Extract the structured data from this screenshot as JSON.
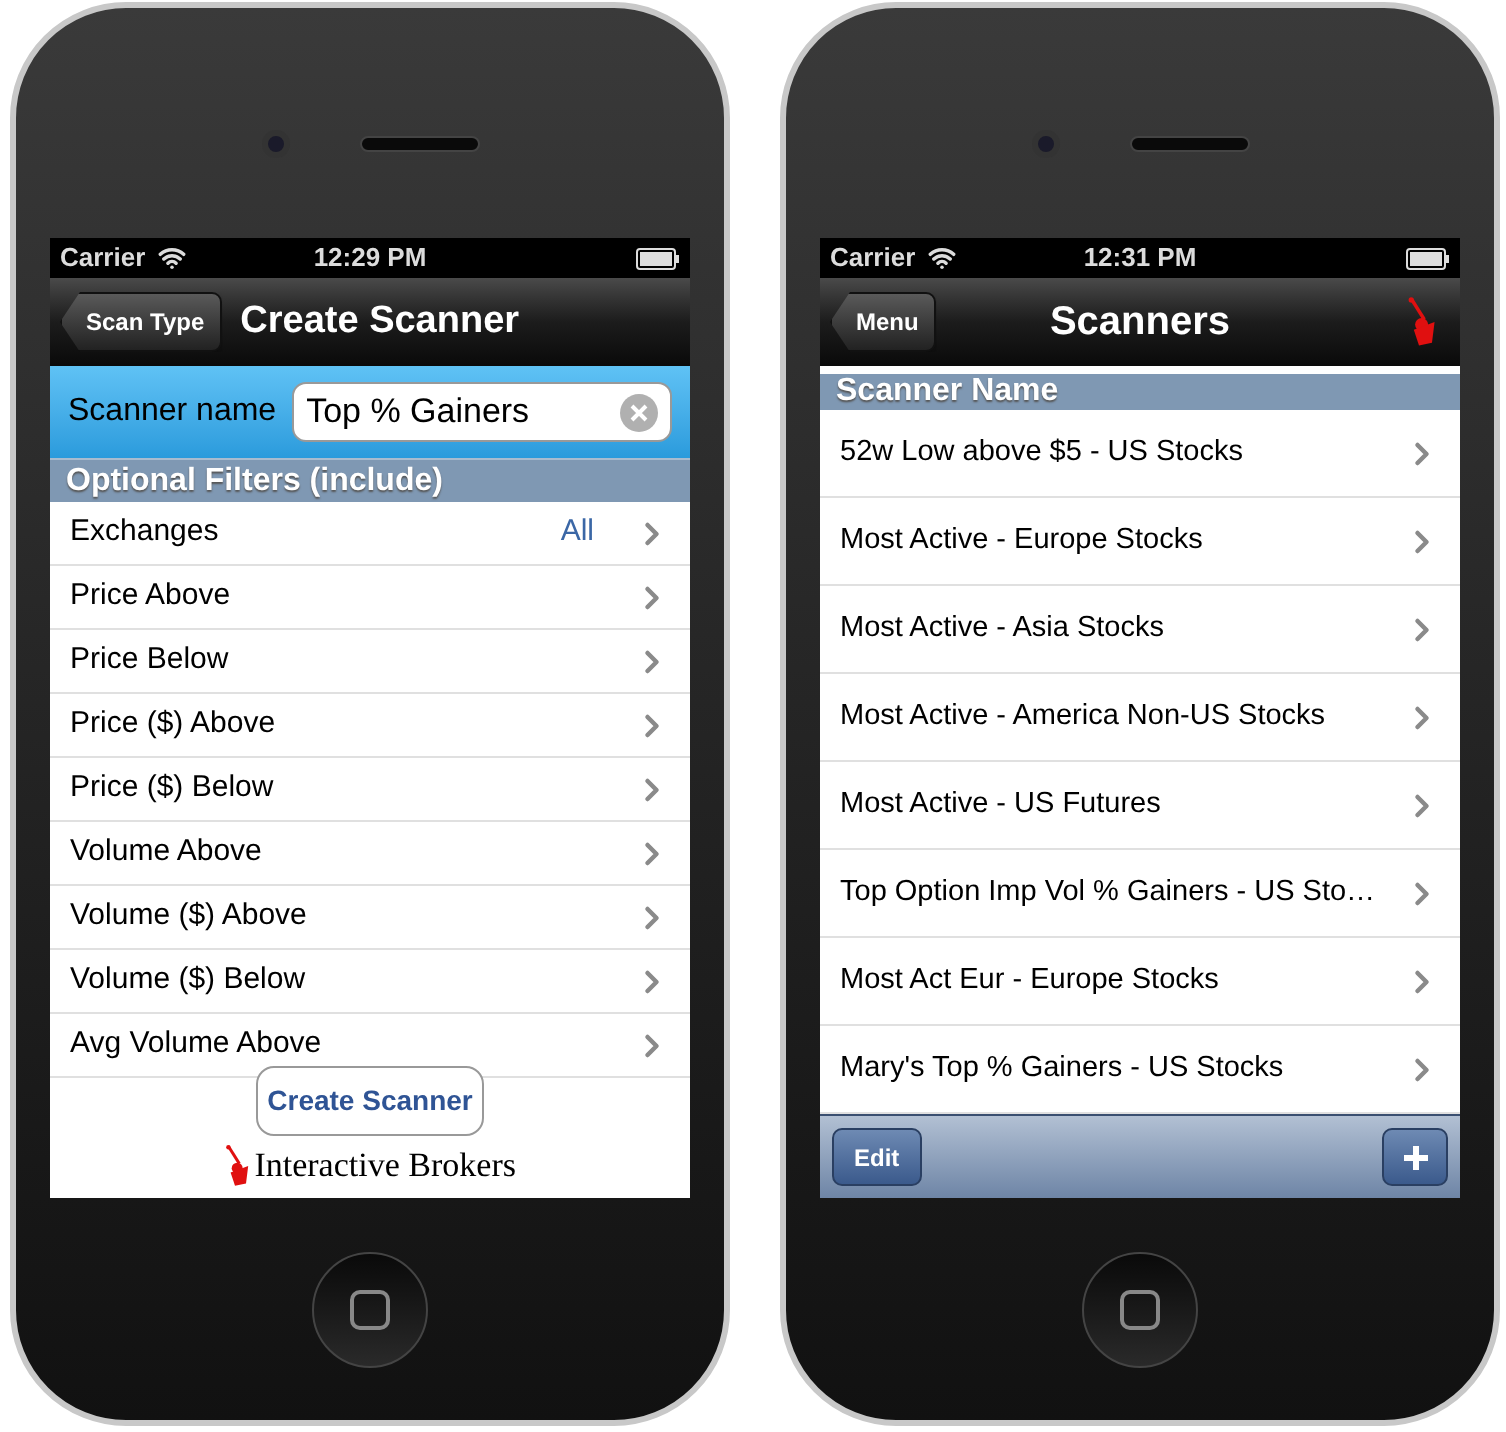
{
  "create_scanner_screen": {
    "status_bar": {
      "carrier": "Carrier",
      "time": "12:29 PM"
    },
    "nav_bar": {
      "back_button": "Scan Type",
      "title": "Create Scanner"
    },
    "name_field": {
      "label": "Scanner name",
      "value": "Top % Gainers"
    },
    "section_header": "Optional Filters (include)",
    "filters": [
      {
        "label": "Exchanges",
        "value": "All"
      },
      {
        "label": "Price Above"
      },
      {
        "label": "Price Below"
      },
      {
        "label": "Price ($) Above"
      },
      {
        "label": "Price ($) Below"
      },
      {
        "label": "Volume Above"
      },
      {
        "label": "Volume ($) Above"
      },
      {
        "label": "Volume ($) Below"
      },
      {
        "label": "Avg Volume Above"
      }
    ],
    "create_button": "Create Scanner",
    "brand": "Interactive Brokers"
  },
  "scanners_screen": {
    "status_bar": {
      "carrier": "Carrier",
      "time": "12:31 PM"
    },
    "nav_bar": {
      "back_button": "Menu",
      "title": "Scanners"
    },
    "list_header": "Scanner Name",
    "rows": [
      "52w Low above $5 - US Stocks",
      "Most Active - Europe Stocks",
      "Most Active - Asia Stocks",
      "Most Active - America Non-US Stocks",
      "Most Active - US Futures",
      "Top Option Imp Vol % Gainers - US Sto…",
      "Most Act Eur - Europe Stocks",
      "Mary's Top % Gainers - US Stocks"
    ],
    "toolbar": {
      "edit_button": "Edit"
    }
  }
}
